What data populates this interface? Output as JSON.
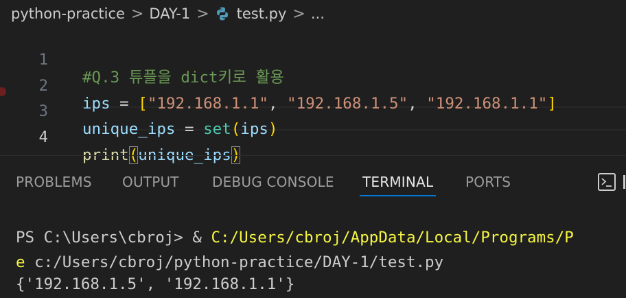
{
  "breadcrumb": {
    "items": [
      "python-practice",
      "DAY-1",
      "test.py",
      "..."
    ],
    "separator": ">"
  },
  "editor": {
    "lines": [
      {
        "number": "1",
        "tokens": [
          {
            "text": "#Q.3 튜플을 dict키로 활용",
            "type": "comment"
          }
        ]
      },
      {
        "number": "2",
        "tokens": [
          {
            "text": "ips",
            "type": "var"
          },
          {
            "text": " = ",
            "type": "op"
          },
          {
            "text": "[",
            "type": "b1"
          },
          {
            "text": "\"192.168.1.1\"",
            "type": "str"
          },
          {
            "text": ", ",
            "type": "op"
          },
          {
            "text": "\"192.168.1.5\"",
            "type": "str"
          },
          {
            "text": ", ",
            "type": "op"
          },
          {
            "text": "\"192.168.1.1\"",
            "type": "str"
          },
          {
            "text": "]",
            "type": "b1"
          }
        ]
      },
      {
        "number": "3",
        "tokens": [
          {
            "text": "unique_ips",
            "type": "var"
          },
          {
            "text": " = ",
            "type": "op"
          },
          {
            "text": "set",
            "type": "builtin"
          },
          {
            "text": "(",
            "type": "b1"
          },
          {
            "text": "ips",
            "type": "var"
          },
          {
            "text": ")",
            "type": "b1"
          }
        ]
      },
      {
        "number": "4",
        "tokens": [
          {
            "text": "print",
            "type": "fn"
          },
          {
            "text": "(",
            "type": "b1"
          },
          {
            "text": "unique_ips",
            "type": "var"
          },
          {
            "text": ")",
            "type": "b1"
          }
        ]
      }
    ]
  },
  "panel": {
    "tabs": [
      "PROBLEMS",
      "OUTPUT",
      "DEBUG CONSOLE",
      "TERMINAL",
      "PORTS"
    ],
    "active_tab": "TERMINAL"
  },
  "terminal": {
    "prompt": "PS C:\\Users\\cbroj> & ",
    "command_line1": "C:/Users/cbroj/AppData/Local/Programs/P",
    "command_line2_prefix": "e",
    "command_line2_rest": " c:/Users/cbroj/python-practice/DAY-1/test.py",
    "output": "{'192.168.1.5', '192.168.1.1'}"
  },
  "colors": {
    "background": "#1f1f1f",
    "accent": "#0078d4",
    "comment": "#6a9955",
    "string": "#ce9178",
    "variable": "#9cdcfe",
    "bracket": "#ffd700",
    "function": "#dcdcaa",
    "builtin": "#4ec9b0",
    "terminal_command": "#f5f543"
  },
  "icons": {
    "file_icon": "python-icon",
    "panel_icon": "terminal-icon"
  }
}
